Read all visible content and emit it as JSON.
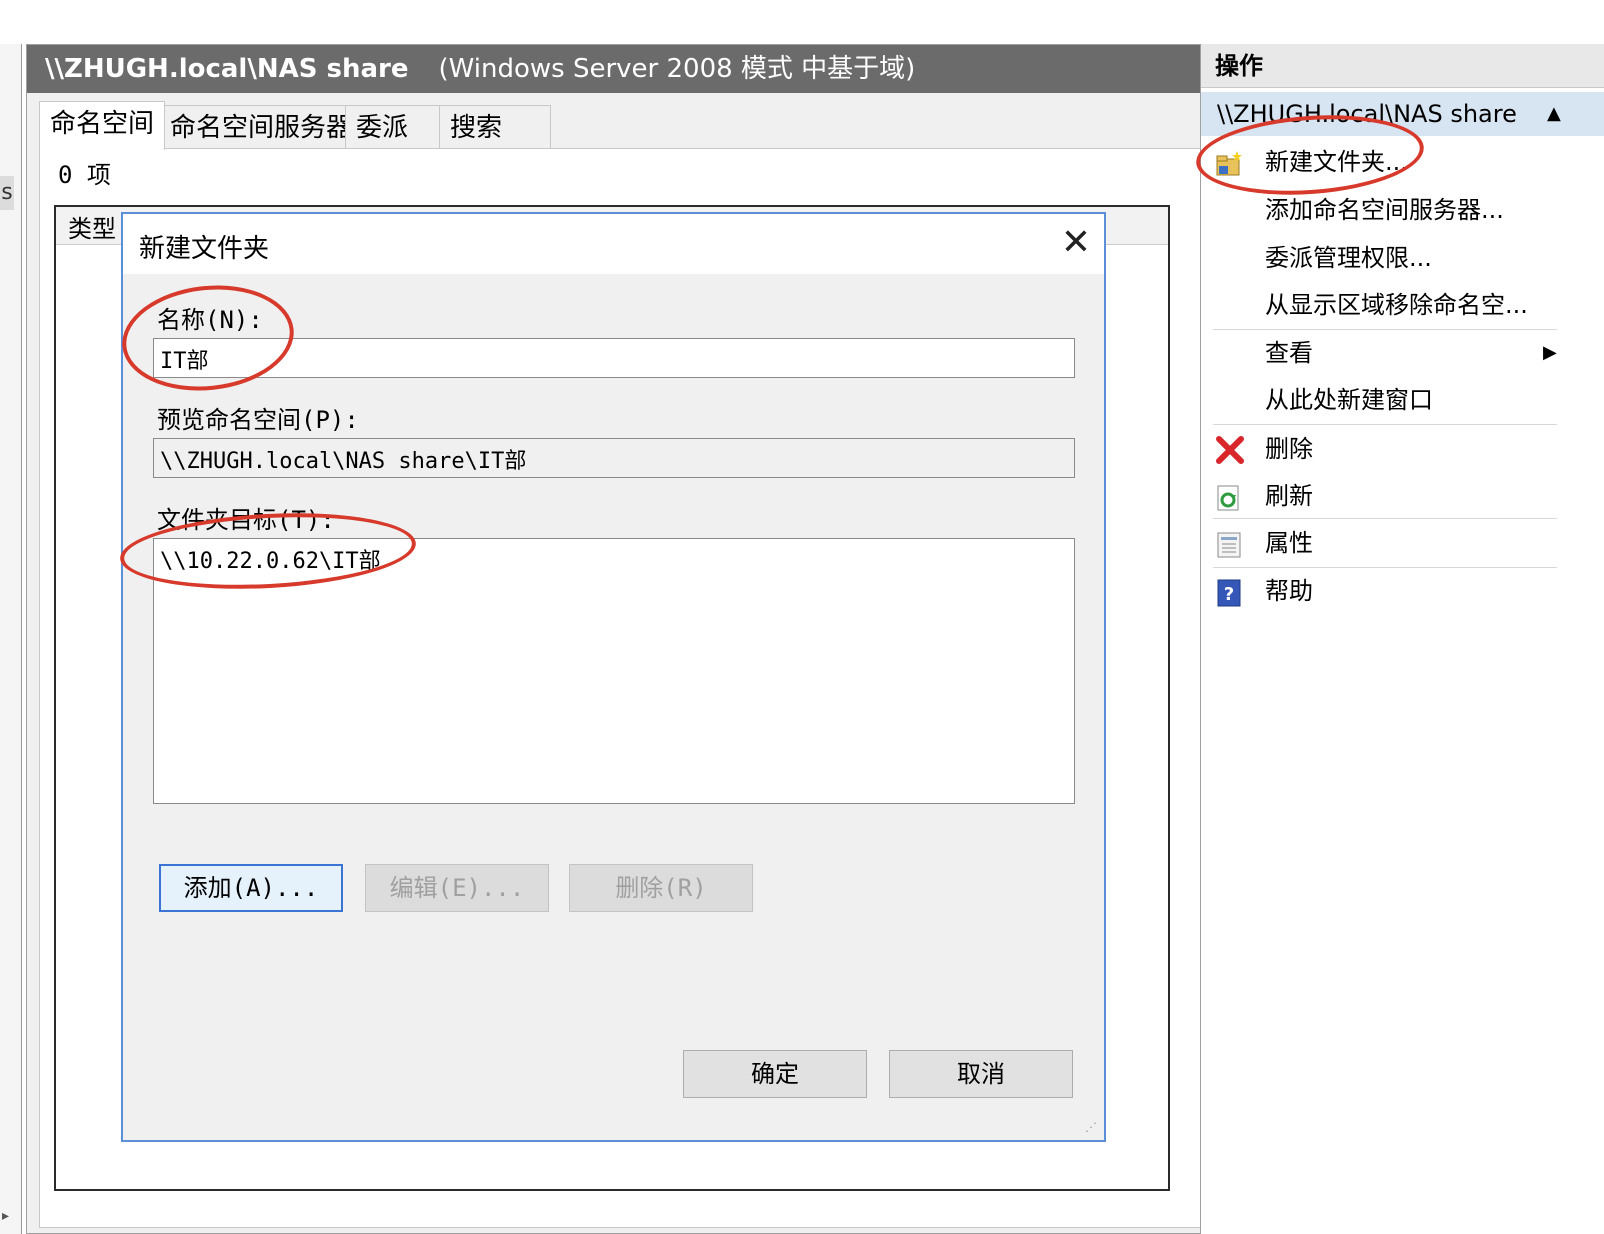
{
  "left_strip": {
    "fragment": "s"
  },
  "center": {
    "title_path": "\\\\ZHUGH.local\\NAS share",
    "title_mode": "(Windows Server 2008 模式 中基于域)",
    "tabs": [
      {
        "label": "命名空间"
      },
      {
        "label": "命名空间服务器"
      },
      {
        "label": "委派"
      },
      {
        "label": "搜索"
      }
    ],
    "item_count": "0 项",
    "list_column": "类型"
  },
  "dialog": {
    "title": "新建文件夹",
    "close_glyph": "✕",
    "name_label": "名称(N):",
    "name_value": "IT部",
    "preview_label": "预览命名空间(P):",
    "preview_value": "\\\\ZHUGH.local\\NAS share\\IT部",
    "targets_label": "文件夹目标(T):",
    "targets": [
      "\\\\10.22.0.62\\IT部"
    ],
    "buttons": {
      "add": "添加(A)...",
      "edit": "编辑(E)...",
      "remove": "删除(R)",
      "ok": "确定",
      "cancel": "取消"
    }
  },
  "actions": {
    "header": "操作",
    "subheader": "\\\\ZHUGH.local\\NAS share",
    "items": [
      {
        "label": "新建文件夹...",
        "icon": "new-folder-icon"
      },
      {
        "label": "添加命名空间服务器..."
      },
      {
        "label": "委派管理权限..."
      },
      {
        "label": "从显示区域移除命名空..."
      },
      {
        "label": "查看",
        "submenu": true
      },
      {
        "label": "从此处新建窗口"
      },
      {
        "label": "删除",
        "icon": "delete-icon"
      },
      {
        "label": "刷新",
        "icon": "refresh-icon"
      },
      {
        "label": "属性",
        "icon": "properties-icon"
      },
      {
        "label": "帮助",
        "icon": "help-icon"
      }
    ]
  },
  "colors": {
    "annotation": "#d7392b",
    "dialog_border": "#5b8fd8",
    "title_bar": "#6b6b6b",
    "actions_highlight": "#d7e4f2"
  }
}
